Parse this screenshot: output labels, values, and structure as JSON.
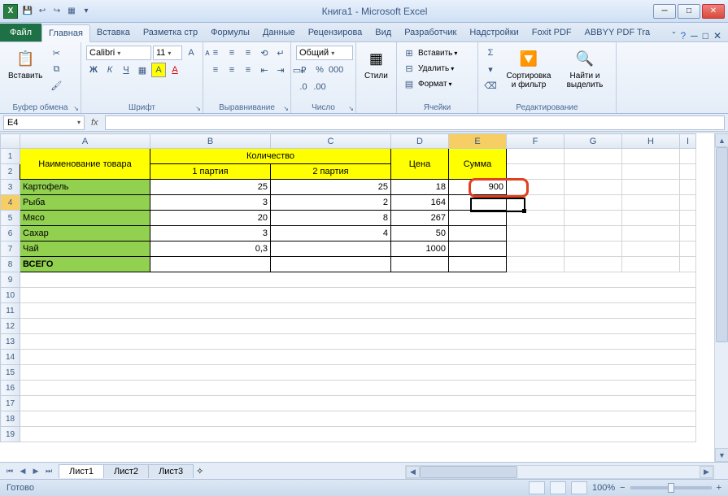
{
  "title": "Книга1 - Microsoft Excel",
  "tabs": {
    "file": "Файл",
    "home": "Главная",
    "insert": "Вставка",
    "layout": "Разметка стр",
    "formulas": "Формулы",
    "data": "Данные",
    "review": "Рецензирова",
    "view": "Вид",
    "developer": "Разработчик",
    "addins": "Надстройки",
    "foxit": "Foxit PDF",
    "abbyy": "ABBYY PDF Tra"
  },
  "ribbon": {
    "paste": "Вставить",
    "clipboard": "Буфер обмена",
    "font_group": "Шрифт",
    "font_name": "Calibri",
    "font_size": "11",
    "align_group": "Выравнивание",
    "number_group": "Число",
    "number_format": "Общий",
    "styles": "Стили",
    "cells_group": "Ячейки",
    "insert": "Вставить",
    "delete": "Удалить",
    "format": "Формат",
    "editing_group": "Редактирование",
    "sort": "Сортировка и фильтр",
    "find": "Найти и выделить"
  },
  "namebox": "E4",
  "columns": [
    "A",
    "B",
    "C",
    "D",
    "E",
    "F",
    "G",
    "H",
    "I"
  ],
  "rows": [
    "1",
    "2",
    "3",
    "4",
    "5",
    "6",
    "7",
    "8",
    "9",
    "10",
    "11",
    "12",
    "13",
    "14",
    "15",
    "16",
    "17",
    "18",
    "19"
  ],
  "table": {
    "name_header": "Наименование товара",
    "qty_header": "Количество",
    "batch1": "1 партия",
    "batch2": "2 партия",
    "price": "Цена",
    "sum": "Сумма",
    "r3": {
      "name": "Картофель",
      "b": "25",
      "c": "25",
      "d": "18",
      "e": "900"
    },
    "r4": {
      "name": "Рыба",
      "b": "3",
      "c": "2",
      "d": "164"
    },
    "r5": {
      "name": "Мясо",
      "b": "20",
      "c": "8",
      "d": "267"
    },
    "r6": {
      "name": "Сахар",
      "b": "3",
      "c": "4",
      "d": "50"
    },
    "r7": {
      "name": "Чай",
      "b": "0,3",
      "c": "",
      "d": "1000"
    },
    "r8": {
      "name": "ВСЕГО"
    }
  },
  "sheets": {
    "s1": "Лист1",
    "s2": "Лист2",
    "s3": "Лист3"
  },
  "status": {
    "ready": "Готово",
    "zoom": "100%"
  }
}
